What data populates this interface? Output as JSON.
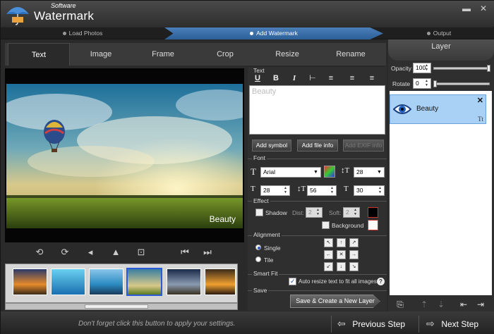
{
  "app": {
    "brand_small": "Software",
    "brand_big": "Watermark"
  },
  "window": {
    "min_label": "▬",
    "close_label": "✕"
  },
  "steps": [
    {
      "label": "Load Photos"
    },
    {
      "label": "Add Watermark"
    },
    {
      "label": "Output"
    }
  ],
  "tabs": [
    {
      "label": "Text"
    },
    {
      "label": "Image"
    },
    {
      "label": "Frame"
    },
    {
      "label": "Crop"
    },
    {
      "label": "Resize"
    },
    {
      "label": "Rename"
    }
  ],
  "preview": {
    "watermark_text": "Beauty"
  },
  "text_section": {
    "title": "Text",
    "content": "Beauty",
    "add_symbol": "Add symbol",
    "add_file_info": "Add file info",
    "add_exif_info": "Add EXIF info"
  },
  "font_section": {
    "title": "Font",
    "font_name": "Arial",
    "size": "28",
    "spacing1": "28",
    "spacing2": "56",
    "spacing3": "30"
  },
  "effect_section": {
    "title": "Effect",
    "shadow_label": "Shadow",
    "dist_label": "Dist:",
    "dist_value": "2",
    "soft_label": "Soft:",
    "soft_value": "2",
    "background_label": "Background"
  },
  "alignment_section": {
    "title": "Alignment",
    "single_label": "Single",
    "tile_label": "Tile"
  },
  "smartfit_section": {
    "title": "Smart Fit",
    "auto_resize_label": "Auto resize text to fit all images."
  },
  "save_section": {
    "title": "Save",
    "button": "Save & Create a New Layer"
  },
  "layer_panel": {
    "title": "Layer",
    "opacity_label": "Opacity",
    "opacity_value": "100",
    "opacity_level": 1.0,
    "rotate_label": "Rotate",
    "rotate_value": "0",
    "rotate_level": 0.0,
    "layer_name": "Beauty"
  },
  "footer": {
    "hint": "Don't forget click this button to apply your settings.",
    "previous": "Previous Step",
    "next": "Next Step"
  },
  "colors": {
    "accent": "#2c5f98",
    "layer_selected": "#a9d1f5"
  }
}
